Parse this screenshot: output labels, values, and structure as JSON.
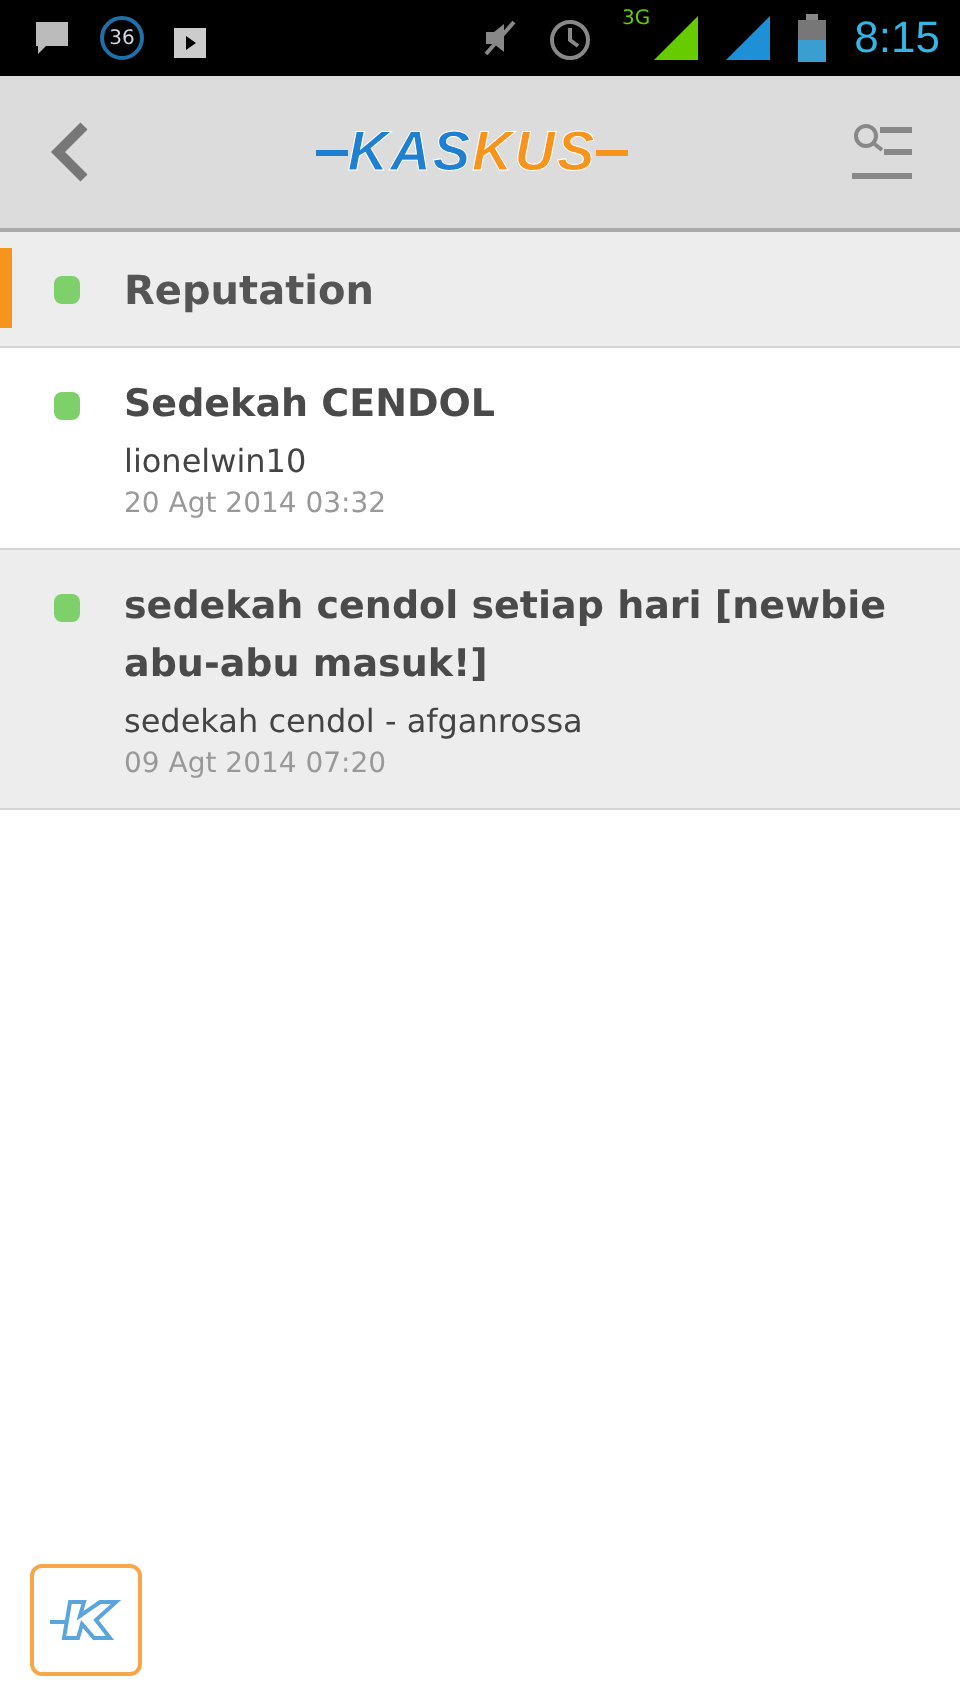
{
  "status_bar": {
    "badge": "36",
    "network": "3G",
    "time": "8:15"
  },
  "app_bar": {
    "logo": [
      {
        "text": "KAS",
        "color": "#1f7fd0"
      },
      {
        "text": "KUS",
        "color": "#f7941d"
      }
    ]
  },
  "section": {
    "title": "Reputation",
    "selected": true,
    "color": "#7ed06a"
  },
  "items": [
    {
      "title": "Sedekah CENDOL",
      "subtitle": "lionelwin10",
      "date": "20 Agt 2014 03:32",
      "color": "#7ed06a",
      "highlighted": false
    },
    {
      "title": "sedekah cendol setiap hari [newbie abu-abu masuk!]",
      "subtitle": "sedekah cendol - afganrossa",
      "date": "09 Agt 2014 07:20",
      "color": "#7ed06a",
      "highlighted": true
    }
  ]
}
